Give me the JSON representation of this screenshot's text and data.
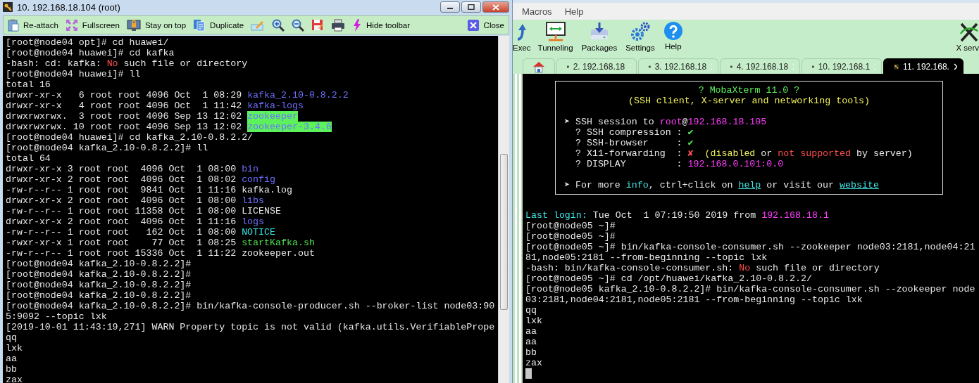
{
  "left_window": {
    "title": "10. 192.168.18.104 (root)",
    "toolbar": [
      {
        "kind": "labeled",
        "label": "Re-attach"
      },
      {
        "kind": "labeled",
        "label": "Fullscreen"
      },
      {
        "kind": "labeled",
        "label": "Stay on top"
      },
      {
        "kind": "labeled",
        "label": "Duplicate"
      },
      {
        "kind": "icon"
      },
      {
        "kind": "icon"
      },
      {
        "kind": "icon"
      },
      {
        "kind": "icon"
      },
      {
        "kind": "icon"
      },
      {
        "kind": "labeled",
        "label": "Hide toolbar"
      },
      {
        "kind": "labeled",
        "label": "Close"
      }
    ],
    "terminal": [
      [
        "[root@node04 opt]# cd huawei/"
      ],
      [
        "[root@node04 huawei]# cd kafka"
      ],
      [
        "-bash: cd: kafka: ",
        {
          "text": "No",
          "color": "#ff4d4d"
        },
        " such file or directory"
      ],
      [
        "[root@node04 huawei]# ll"
      ],
      [
        "total 16"
      ],
      [
        "drwxr-xr-x   6 root root 4096 Oct  1 08:29 ",
        {
          "text": "kafka_2.10-0.8.2.2",
          "color": "#6f6fff"
        }
      ],
      [
        "drwxr-xr-x   4 root root 4096 Oct  1 11:42 ",
        {
          "text": "kafka-logs",
          "color": "#6f6fff"
        }
      ],
      [
        "drwxrwxrwx.  3 root root 4096 Sep 13 12:02 ",
        {
          "text": "zookeeper",
          "highlight": true
        }
      ],
      [
        "drwxrwxrwx. 10 root root 4096 Sep 13 12:02 ",
        {
          "text": "zookeeper-3.4.6",
          "highlight": true
        }
      ],
      [
        "[root@node04 huawei]# cd kafka_2.10-0.8.2.2/"
      ],
      [
        "[root@node04 kafka_2.10-0.8.2.2]# ll"
      ],
      [
        "total 64"
      ],
      [
        "drwxr-xr-x 3 root root  4096 Oct  1 08:00 ",
        {
          "text": "bin",
          "color": "#6f6fff"
        }
      ],
      [
        "drwxr-xr-x 2 root root  4096 Oct  1 08:02 ",
        {
          "text": "config",
          "color": "#6f6fff"
        }
      ],
      [
        "-rw-r--r-- 1 root root  9841 Oct  1 11:16 kafka.log"
      ],
      [
        "drwxr-xr-x 2 root root  4096 Oct  1 08:00 ",
        {
          "text": "libs",
          "color": "#6f6fff"
        }
      ],
      [
        "-rw-r--r-- 1 root root 11358 Oct  1 08:00 LICENSE"
      ],
      [
        "drwxr-xr-x 2 root root  4096 Oct  1 11:16 ",
        {
          "text": "logs",
          "color": "#6f6fff"
        }
      ],
      [
        "-rw-r--r-- 1 root root   162 Oct  1 08:00 ",
        {
          "text": "NOTICE",
          "color": "#33e6e6"
        }
      ],
      [
        "-rwxr-xr-x 1 root root    77 Oct  1 08:25 ",
        {
          "text": "startKafka.sh",
          "color": "#4fe04f"
        }
      ],
      [
        "-rw-r--r-- 1 root root 15336 Oct  1 11:22 zookeeper.out"
      ],
      [
        "[root@node04 kafka_2.10-0.8.2.2]#"
      ],
      [
        "[root@node04 kafka_2.10-0.8.2.2]#"
      ],
      [
        "[root@node04 kafka_2.10-0.8.2.2]#"
      ],
      [
        "[root@node04 kafka_2.10-0.8.2.2]#"
      ],
      [
        "[root@node04 kafka_2.10-0.8.2.2]# bin/kafka-console-producer.sh --broker-list node03:90"
      ],
      [
        "5:9092 --topic lxk"
      ],
      [
        "[2019-10-01 11:43:19,271] WARN Property topic is not valid (kafka.utils.VerifiablePrope"
      ],
      [
        "qq"
      ],
      [
        "lxk"
      ],
      [
        "aa"
      ],
      [
        "bb"
      ],
      [
        "zax"
      ]
    ]
  },
  "right_window": {
    "menu": [
      "Macros",
      "Help"
    ],
    "toolbar": [
      {
        "label": "Exec"
      },
      {
        "label": "Tunneling"
      },
      {
        "label": "Packages"
      },
      {
        "label": "Settings"
      },
      {
        "label": "Help"
      },
      {
        "label": "X serv"
      }
    ],
    "tabs": [
      {
        "kind": "home",
        "selected": false
      },
      {
        "kind": "session",
        "label": "2. 192.168.18",
        "selected": false
      },
      {
        "kind": "session",
        "label": "3. 192.168.18",
        "selected": false
      },
      {
        "kind": "session",
        "label": "4. 192.168.18",
        "selected": false
      },
      {
        "kind": "session",
        "label": "10. 192.168.1",
        "selected": false
      },
      {
        "kind": "session",
        "label": "11. 192.168.",
        "selected": true
      }
    ],
    "banner": {
      "title_lines": [
        [
          {
            "text": "? MobaXterm 11.0 ?",
            "color": "#5ef05e"
          }
        ],
        [
          {
            "text": "(SSH client, X-server and networking tools)",
            "color": "#f0f05a"
          }
        ]
      ],
      "details": [
        [
          "➤ SSH session to ",
          {
            "text": "root",
            "color": "#ff3cff"
          },
          "@",
          {
            "text": "192.168.18.105",
            "color": "#ff3cff"
          }
        ],
        [
          "  ? SSH compression : ",
          {
            "text": "✔",
            "color": "#4fe04f"
          }
        ],
        [
          "  ? SSH-browser     : ",
          {
            "text": "✔",
            "color": "#4fe04f"
          }
        ],
        [
          "  ? X11-forwarding  : ",
          {
            "text": "✘",
            "color": "#ff4d4d"
          },
          {
            "text": "  (disabled",
            "color": "#f0f05a"
          },
          " or ",
          {
            "text": "not supported",
            "color": "#ff4d4d"
          },
          " by server)"
        ],
        [
          "  ? DISPLAY         : ",
          {
            "text": "192.168.0.101:0.0",
            "color": "#ff3cff"
          }
        ]
      ],
      "footer": [
        [
          "➤ For more ",
          {
            "text": "info",
            "color": "#3ee6e6"
          },
          ", ctrl+click on ",
          {
            "text": "help",
            "color": "#3ee6e6",
            "link": true
          },
          " or visit our ",
          {
            "text": "website",
            "color": "#3ee6e6",
            "link": true
          }
        ]
      ]
    },
    "terminal": [
      [
        {
          "text": "Last login:",
          "color": "#3ee6e6"
        },
        " Tue Oct  1 07:19:50 2019 from ",
        {
          "text": "192.168.18.1",
          "color": "#ff3cff"
        }
      ],
      [
        "[root@node05 ~]#"
      ],
      [
        "[root@node05 ~]#"
      ],
      [
        "[root@node05 ~]# bin/kafka-console-consumer.sh --zookeeper node03:2181,node04:21"
      ],
      [
        "81,node05:2181 --from-beginning --topic lxk"
      ],
      [
        "-bash: bin/kafka-console-consumer.sh: ",
        {
          "text": "No",
          "color": "#ff4d4d"
        },
        " such file or directory"
      ],
      [
        "[root@node05 ~]# cd /opt/huawei/kafka_2.10-0.8.2.2/"
      ],
      [
        "[root@node05 kafka_2.10-0.8.2.2]# bin/kafka-console-consumer.sh --zookeeper node"
      ],
      [
        "03:2181,node04:2181,node05:2181 --from-beginning --topic lxk"
      ],
      [
        "qq"
      ],
      [
        "lxk"
      ],
      [
        "aa"
      ],
      [
        "aa"
      ],
      [
        "bb"
      ],
      [
        "zax"
      ]
    ]
  }
}
